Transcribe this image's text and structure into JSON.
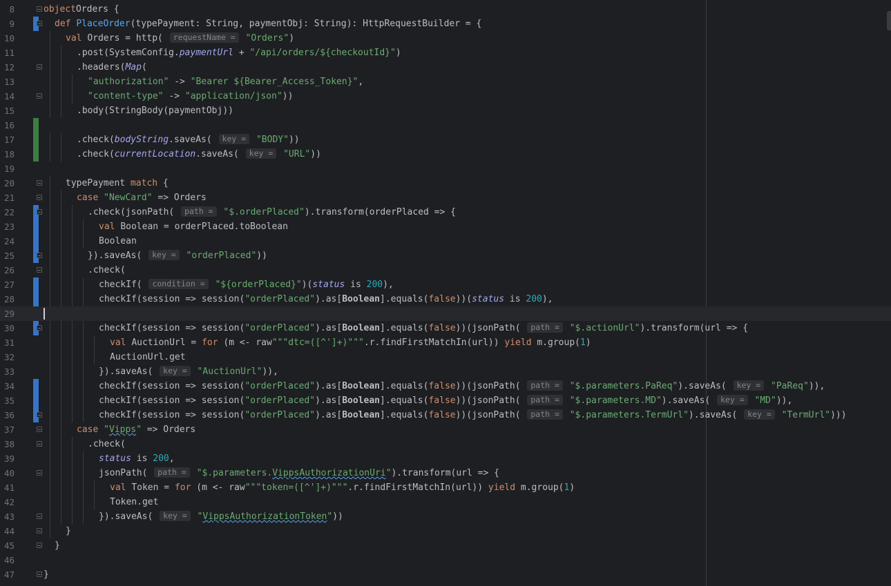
{
  "editor": {
    "lines": [
      {
        "n": "8",
        "fold": true,
        "indent": 0,
        "parts": [
          [
            "kw",
            "object"
          ],
          [
            "",
            "Orders {"
          ]
        ]
      },
      {
        "n": "9",
        "fold": true,
        "indent": 1,
        "mark": "mod",
        "parts": [
          [
            "kw",
            "def "
          ],
          [
            "fn",
            "PlaceOrder"
          ],
          [
            "",
            "(typePayment: "
          ],
          [
            "",
            "String"
          ],
          [
            "",
            ", paymentObj: "
          ],
          [
            "",
            "String"
          ],
          [
            "",
            "): HttpRequestBuilder = {"
          ]
        ]
      },
      {
        "n": "10",
        "indent": 2,
        "parts": [
          [
            "kw",
            "val "
          ],
          [
            "",
            "Orders = http( "
          ],
          [
            "hint",
            "requestName ="
          ],
          [
            "st",
            " \"Orders\""
          ],
          [
            "",
            ")"
          ]
        ]
      },
      {
        "n": "11",
        "indent": 3,
        "parts": [
          [
            "",
            ".post(SystemConfig."
          ],
          [
            "it",
            "paymentUrl"
          ],
          [
            "",
            " + "
          ],
          [
            "st",
            "\"/api/orders/${checkoutId}\""
          ],
          [
            "",
            ")"
          ]
        ]
      },
      {
        "n": "12",
        "fold": true,
        "indent": 3,
        "parts": [
          [
            "",
            ".headers("
          ],
          [
            "it",
            "Map"
          ],
          [
            "",
            "("
          ]
        ]
      },
      {
        "n": "13",
        "indent": 4,
        "parts": [
          [
            "st",
            "\"authorization\""
          ],
          [
            "",
            " -> "
          ],
          [
            "st",
            "\"Bearer ${Bearer_Access_Token}\""
          ],
          [
            "",
            ","
          ]
        ]
      },
      {
        "n": "14",
        "fold": true,
        "indent": 4,
        "parts": [
          [
            "st",
            "\"content-type\""
          ],
          [
            "",
            " -> "
          ],
          [
            "st",
            "\"application/json\""
          ],
          [
            "",
            "))"
          ]
        ]
      },
      {
        "n": "15",
        "indent": 3,
        "parts": [
          [
            "",
            ".body(StringBody(paymentObj))"
          ]
        ]
      },
      {
        "n": "16",
        "indent": 0,
        "mark": "add",
        "parts": []
      },
      {
        "n": "17",
        "indent": 3,
        "mark": "add",
        "parts": [
          [
            "",
            ".check("
          ],
          [
            "it",
            "bodyString"
          ],
          [
            "",
            ".saveAs( "
          ],
          [
            "hint",
            "key ="
          ],
          [
            "st",
            " \"BODY\""
          ],
          [
            "",
            "))"
          ]
        ]
      },
      {
        "n": "18",
        "indent": 3,
        "mark": "add",
        "parts": [
          [
            "",
            ".check("
          ],
          [
            "it",
            "currentLocation"
          ],
          [
            "",
            ".saveAs( "
          ],
          [
            "hint",
            "key ="
          ],
          [
            "st",
            " \"URL\""
          ],
          [
            "",
            "))"
          ]
        ]
      },
      {
        "n": "19",
        "indent": 0,
        "parts": []
      },
      {
        "n": "20",
        "fold": true,
        "indent": 2,
        "parts": [
          [
            "",
            "typePayment "
          ],
          [
            "kw",
            "match"
          ],
          [
            "",
            " {"
          ]
        ]
      },
      {
        "n": "21",
        "fold": true,
        "indent": 3,
        "parts": [
          [
            "kw",
            "case "
          ],
          [
            "st",
            "\"NewCard\""
          ],
          [
            "",
            " => Orders"
          ]
        ]
      },
      {
        "n": "22",
        "fold": true,
        "indent": 4,
        "mark": "mod",
        "parts": [
          [
            "",
            ".check(jsonPath( "
          ],
          [
            "hint",
            "path ="
          ],
          [
            "st",
            " \"$.orderPlaced\""
          ],
          [
            "",
            ").transform(orderPlaced => {"
          ]
        ]
      },
      {
        "n": "23",
        "indent": 5,
        "mark": "mod",
        "parts": [
          [
            "kw",
            "val "
          ],
          [
            "",
            "Boolean = orderPlaced.toBoolean"
          ]
        ]
      },
      {
        "n": "24",
        "indent": 5,
        "mark": "mod",
        "parts": [
          [
            "",
            "Boolean"
          ]
        ]
      },
      {
        "n": "25",
        "fold": true,
        "indent": 4,
        "mark": "mod",
        "parts": [
          [
            "",
            "}).saveAs( "
          ],
          [
            "hint",
            "key ="
          ],
          [
            "st",
            " \"orderPlaced\""
          ],
          [
            "",
            "))"
          ]
        ]
      },
      {
        "n": "26",
        "fold": true,
        "indent": 4,
        "parts": [
          [
            "",
            ".check("
          ]
        ]
      },
      {
        "n": "27",
        "indent": 5,
        "mark": "mod",
        "parts": [
          [
            "",
            "checkIf( "
          ],
          [
            "hint",
            "condition ="
          ],
          [
            "st",
            " \"${orderPlaced}\""
          ],
          [
            "",
            ")("
          ],
          [
            "pf",
            "status"
          ],
          [
            "",
            " is "
          ],
          [
            "nm",
            "200"
          ],
          [
            "",
            "),"
          ]
        ]
      },
      {
        "n": "28",
        "indent": 5,
        "mark": "mod",
        "parts": [
          [
            "",
            "checkIf(session => session("
          ],
          [
            "st",
            "\"orderPlaced\""
          ],
          [
            "",
            ").as["
          ],
          [
            "ty",
            "Boolean"
          ],
          [
            "",
            "].equals("
          ],
          [
            "kw",
            "false"
          ],
          [
            "",
            "))("
          ],
          [
            "pf",
            "status"
          ],
          [
            "",
            " is "
          ],
          [
            "nm",
            "200"
          ],
          [
            "",
            "),"
          ]
        ]
      },
      {
        "n": "29",
        "indent": 0,
        "current": true,
        "caret": true,
        "parts": []
      },
      {
        "n": "30",
        "fold": true,
        "indent": 5,
        "mark": "mod",
        "parts": [
          [
            "",
            "checkIf(session => session("
          ],
          [
            "st",
            "\"orderPlaced\""
          ],
          [
            "",
            ").as["
          ],
          [
            "ty",
            "Boolean"
          ],
          [
            "",
            "].equals("
          ],
          [
            "kw",
            "false"
          ],
          [
            "",
            "))(jsonPath( "
          ],
          [
            "hint",
            "path ="
          ],
          [
            "st",
            " \"$.actionUrl\""
          ],
          [
            "",
            ").transform(url => {"
          ]
        ]
      },
      {
        "n": "31",
        "indent": 6,
        "parts": [
          [
            "kw",
            "val "
          ],
          [
            "",
            "AuctionUrl = "
          ],
          [
            "kw",
            "for"
          ],
          [
            "",
            " (m <- raw"
          ],
          [
            "st",
            "\"\"\"dtc=([^']+)\"\"\""
          ],
          [
            "",
            ".r.findFirstMatchIn(url)) "
          ],
          [
            "kw",
            "yield"
          ],
          [
            "",
            " m.group("
          ],
          [
            "nm",
            "1"
          ],
          [
            "",
            ")"
          ]
        ]
      },
      {
        "n": "32",
        "indent": 6,
        "parts": [
          [
            "",
            "AuctionUrl.get"
          ]
        ]
      },
      {
        "n": "33",
        "indent": 5,
        "parts": [
          [
            "",
            "}).saveAs( "
          ],
          [
            "hint",
            "key ="
          ],
          [
            "st",
            " \"AuctionUrl\""
          ],
          [
            "",
            ")),"
          ]
        ]
      },
      {
        "n": "34",
        "indent": 5,
        "mark": "mod",
        "parts": [
          [
            "",
            "checkIf(session => session("
          ],
          [
            "st",
            "\"orderPlaced\""
          ],
          [
            "",
            ").as["
          ],
          [
            "ty",
            "Boolean"
          ],
          [
            "",
            "].equals("
          ],
          [
            "kw",
            "false"
          ],
          [
            "",
            "))(jsonPath( "
          ],
          [
            "hint",
            "path ="
          ],
          [
            "st",
            " \"$.parameters.PaReq\""
          ],
          [
            "",
            ").saveAs( "
          ],
          [
            "hint",
            "key ="
          ],
          [
            "st",
            " \"PaReq\""
          ],
          [
            "",
            ")),"
          ]
        ]
      },
      {
        "n": "35",
        "indent": 5,
        "mark": "mod",
        "parts": [
          [
            "",
            "checkIf(session => session("
          ],
          [
            "st",
            "\"orderPlaced\""
          ],
          [
            "",
            ").as["
          ],
          [
            "ty",
            "Boolean"
          ],
          [
            "",
            "].equals("
          ],
          [
            "kw",
            "false"
          ],
          [
            "",
            "))(jsonPath( "
          ],
          [
            "hint",
            "path ="
          ],
          [
            "st",
            " \"$.parameters.MD\""
          ],
          [
            "",
            ").saveAs( "
          ],
          [
            "hint",
            "key ="
          ],
          [
            "st",
            " \"MD\""
          ],
          [
            "",
            ")),"
          ]
        ]
      },
      {
        "n": "36",
        "fold": true,
        "indent": 5,
        "mark": "mod",
        "parts": [
          [
            "",
            "checkIf(session => session("
          ],
          [
            "st",
            "\"orderPlaced\""
          ],
          [
            "",
            ").as["
          ],
          [
            "ty",
            "Boolean"
          ],
          [
            "",
            "].equals("
          ],
          [
            "kw",
            "false"
          ],
          [
            "",
            "))(jsonPath( "
          ],
          [
            "hint",
            "path ="
          ],
          [
            "st",
            " \"$.parameters.TermUrl\""
          ],
          [
            "",
            ").saveAs( "
          ],
          [
            "hint",
            "key ="
          ],
          [
            "st",
            " \"TermUrl\""
          ],
          [
            "",
            ")))"
          ]
        ]
      },
      {
        "n": "37",
        "fold": true,
        "indent": 3,
        "parts": [
          [
            "kw",
            "case "
          ],
          [
            "st",
            "\""
          ],
          [
            "sqst",
            "Vipps"
          ],
          [
            "st",
            "\""
          ],
          [
            "",
            " => Orders"
          ]
        ]
      },
      {
        "n": "38",
        "fold": true,
        "indent": 4,
        "parts": [
          [
            "",
            ".check("
          ]
        ]
      },
      {
        "n": "39",
        "indent": 5,
        "parts": [
          [
            "pf",
            "status"
          ],
          [
            "",
            " is "
          ],
          [
            "nm",
            "200"
          ],
          [
            "",
            ","
          ]
        ]
      },
      {
        "n": "40",
        "fold": true,
        "indent": 5,
        "parts": [
          [
            "",
            "jsonPath( "
          ],
          [
            "hint",
            "path ="
          ],
          [
            "st",
            " \"$.parameters."
          ],
          [
            "sqst",
            "VippsAuthorizationUri"
          ],
          [
            "st",
            "\""
          ],
          [
            "",
            ").transform(url => {"
          ]
        ]
      },
      {
        "n": "41",
        "indent": 6,
        "parts": [
          [
            "kw",
            "val "
          ],
          [
            "",
            "Token = "
          ],
          [
            "kw",
            "for"
          ],
          [
            "",
            " (m <- raw"
          ],
          [
            "st",
            "\"\"\"token=([^']+)\"\"\""
          ],
          [
            "",
            ".r.findFirstMatchIn(url)) "
          ],
          [
            "kw",
            "yield"
          ],
          [
            "",
            " m.group("
          ],
          [
            "nm",
            "1"
          ],
          [
            "",
            ")"
          ]
        ]
      },
      {
        "n": "42",
        "indent": 6,
        "parts": [
          [
            "",
            "Token.get"
          ]
        ]
      },
      {
        "n": "43",
        "fold": true,
        "indent": 5,
        "parts": [
          [
            "",
            "}).saveAs( "
          ],
          [
            "hint",
            "key ="
          ],
          [
            "st",
            " \""
          ],
          [
            "sqst",
            "VippsAuthorizationToken"
          ],
          [
            "st",
            "\""
          ],
          [
            "",
            "))"
          ]
        ]
      },
      {
        "n": "44",
        "fold": true,
        "indent": 2,
        "parts": [
          [
            "",
            "}"
          ]
        ]
      },
      {
        "n": "45",
        "fold": true,
        "indent": 1,
        "parts": [
          [
            "",
            "}"
          ]
        ]
      },
      {
        "n": "46",
        "indent": 0,
        "parts": []
      },
      {
        "n": "47",
        "fold": true,
        "indent": 0,
        "parts": [
          [
            "",
            "}"
          ]
        ]
      }
    ]
  },
  "colors": {
    "background": "#1e1f22",
    "keyword": "#cf8e6d",
    "function": "#56a8f5",
    "string": "#6aab73",
    "number": "#2aacb8",
    "field": "#a4a8f0",
    "text": "#bcbec4",
    "gutter_modified": "#3574c9",
    "gutter_added": "#3c7d44"
  }
}
